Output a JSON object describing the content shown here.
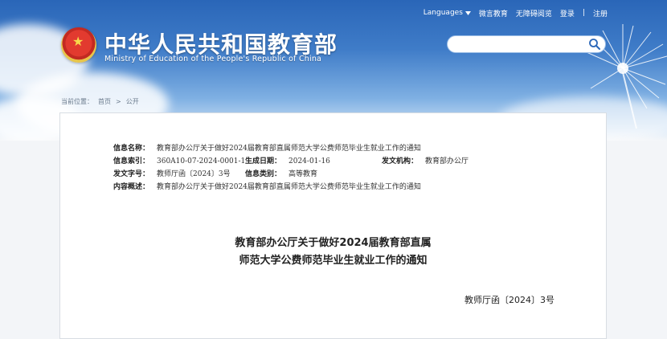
{
  "topnav": {
    "languages": "Languages",
    "weibo": "微言教育",
    "accessibility": "无障碍阅览",
    "login": "登录",
    "separator": "|",
    "register": "注册"
  },
  "site": {
    "title": "中华人民共和国教育部",
    "subtitle": "Ministry of Education of the People's Republic of China"
  },
  "search": {
    "placeholder": ""
  },
  "breadcrumb": {
    "label": "当前位置：",
    "items": [
      "首页",
      "公开"
    ],
    "sep": ">"
  },
  "info": {
    "name_label": "信息名称：",
    "name_value": "教育部办公厅关于做好2024届教育部直属师范大学公费师范毕业生就业工作的通知",
    "index_label": "信息索引：",
    "index_value": "360A10-07-2024-0001-1",
    "date_label": "生成日期：",
    "date_value": "2024-01-16",
    "org_label": "发文机构：",
    "org_value": "教育部办公厅",
    "docno_label": "发文字号：",
    "docno_value": "教师厅函〔2024〕3号",
    "category_label": "信息类别：",
    "category_value": "高等教育",
    "summary_label": "内容概述：",
    "summary_value": "教育部办公厅关于做好2024届教育部直属师范大学公费师范毕业生就业工作的通知"
  },
  "document": {
    "title_line1": "教育部办公厅关于做好2024届教育部直属",
    "title_line2": "师范大学公费师范毕业生就业工作的通知",
    "number": "教师厅函〔2024〕3号"
  },
  "colors": {
    "header_blue": "#2a66b8",
    "panel_border": "#d8dde3"
  }
}
